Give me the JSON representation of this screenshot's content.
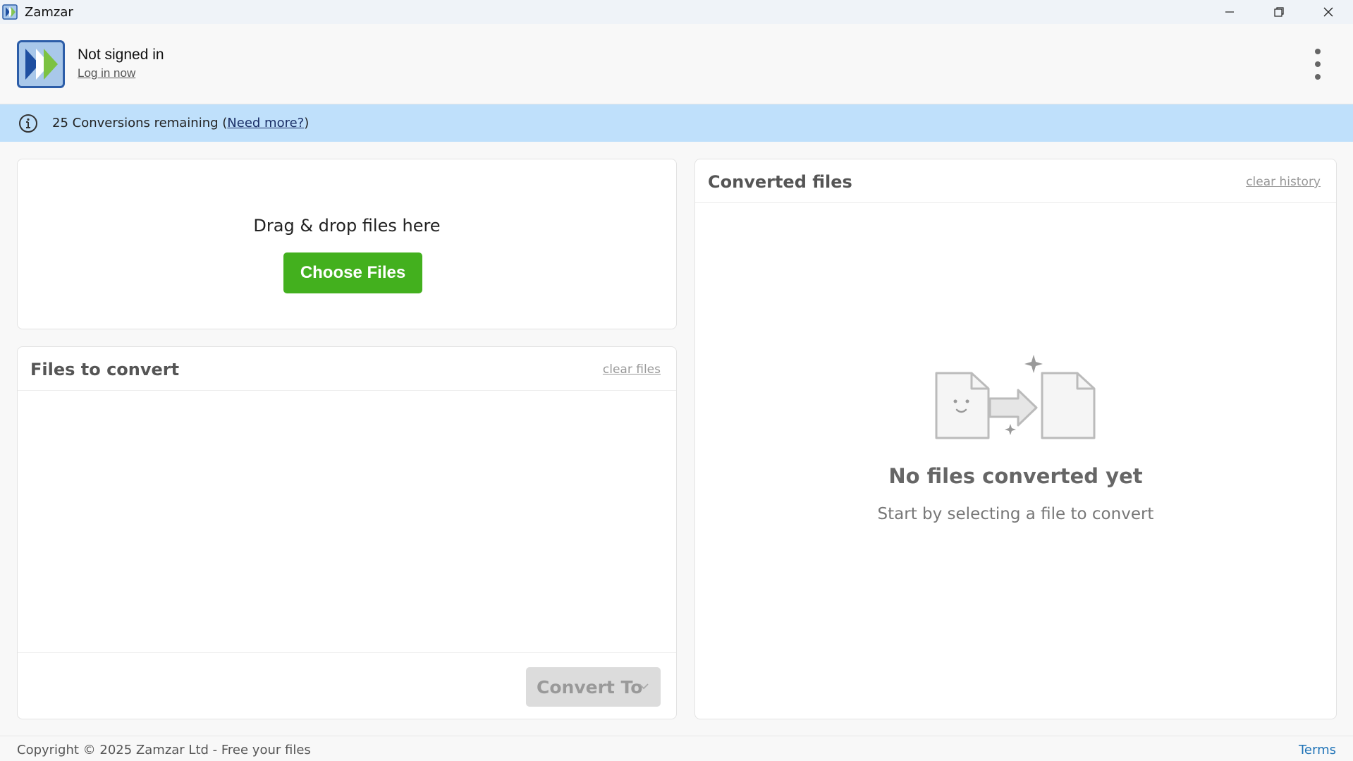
{
  "window": {
    "title": "Zamzar",
    "controls": [
      "minimize-icon",
      "restore-icon",
      "close-icon"
    ]
  },
  "header": {
    "user_status": "Not signed in",
    "login_link": "Log in now",
    "menu_icon": "kebab-menu-icon"
  },
  "banner": {
    "icon": "info-icon",
    "remaining_text": "25 Conversions remaining",
    "open_paren": "(",
    "need_more_link": "Need more?",
    "close_paren": ")",
    "background": "#bfe0fb"
  },
  "drop_zone": {
    "instruction": "Drag & drop files here",
    "choose_button": "Choose Files",
    "button_color": "#43b01e"
  },
  "files_panel": {
    "title": "Files to convert",
    "clear_link": "clear files",
    "convert_button": "Convert To",
    "convert_enabled": false
  },
  "converted_panel": {
    "title": "Converted files",
    "clear_link": "clear history",
    "empty_title": "No files converted yet",
    "empty_subtitle": "Start by selecting a file to convert"
  },
  "footer": {
    "copyright": "Copyright © 2025 Zamzar Ltd - Free your files",
    "terms_link": "Terms",
    "link_color": "#1f73b7"
  }
}
